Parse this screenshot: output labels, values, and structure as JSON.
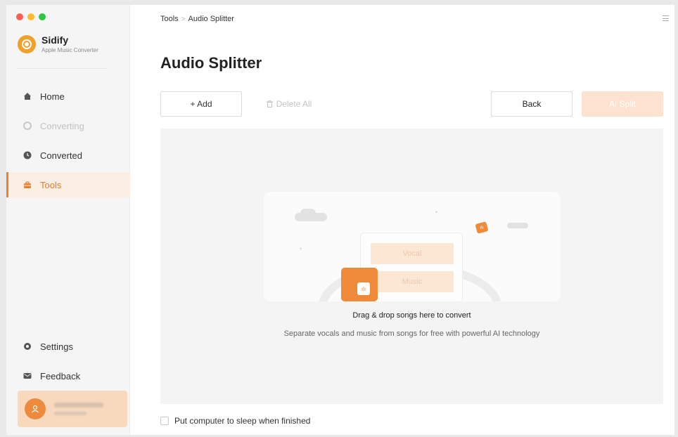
{
  "window": {
    "traffic_lights": [
      "#ff5f57",
      "#febc2e",
      "#28c840"
    ]
  },
  "brand": {
    "name": "Sidify",
    "subtitle": "Apple Music Converter",
    "logo_color": "#f0a12a"
  },
  "sidebar": {
    "items": [
      {
        "label": "Home",
        "icon": "home-icon",
        "state": "normal"
      },
      {
        "label": "Converting",
        "icon": "converting-icon",
        "state": "disabled"
      },
      {
        "label": "Converted",
        "icon": "clock-icon",
        "state": "normal"
      },
      {
        "label": "Tools",
        "icon": "toolbox-icon",
        "state": "active"
      }
    ],
    "bottom_items": [
      {
        "label": "Settings",
        "icon": "gear-icon"
      },
      {
        "label": "Feedback",
        "icon": "mail-icon"
      }
    ]
  },
  "breadcrumb": {
    "parent": "Tools",
    "separator": ">",
    "current": "Audio Splitter"
  },
  "page": {
    "title": "Audio Splitter"
  },
  "toolbar": {
    "add_label": "+ Add",
    "delete_all_label": "Delete All",
    "back_label": "Back",
    "ai_split_label": "AI Split"
  },
  "drop_zone": {
    "pill_vocal": "Vocal",
    "pill_music": "Music",
    "title": "Drag & drop songs here to convert",
    "subtitle": "Separate vocals and music from songs for free with powerful AI technology"
  },
  "footer": {
    "sleep_label": "Put computer to sleep when finished",
    "sleep_checked": false
  },
  "colors": {
    "accent": "#ee7f2d",
    "accent_light": "#fbeee3"
  }
}
